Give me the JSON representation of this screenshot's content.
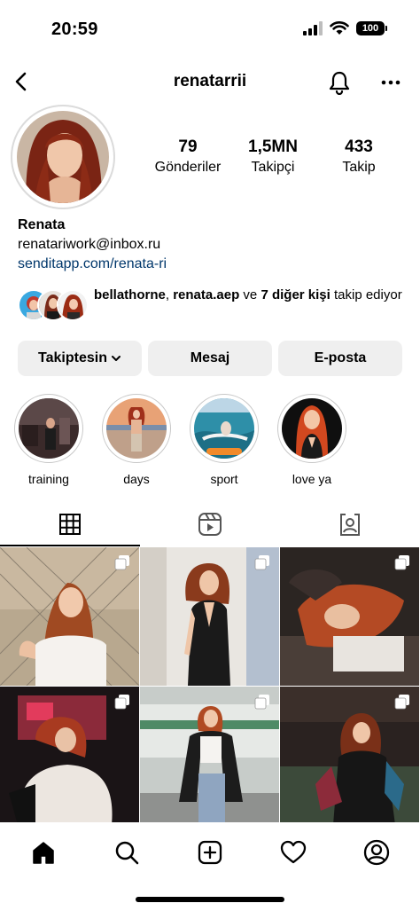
{
  "status_bar": {
    "time": "20:59",
    "battery": "100"
  },
  "header": {
    "username": "renatarrii"
  },
  "profile": {
    "stats": [
      {
        "value": "79",
        "label": "Gönderiler"
      },
      {
        "value": "1,5MN",
        "label": "Takipçi"
      },
      {
        "value": "433",
        "label": "Takip"
      }
    ],
    "name": "Renata",
    "bio_email": "renatariwork@inbox.ru",
    "bio_link": "senditapp.com/renata-ri"
  },
  "followed_by": {
    "user1": "bellathorne",
    "separator": ", ",
    "user2": "renata.aep",
    "connector": " ve ",
    "others": "7 diğer kişi",
    "suffix": " takip ediyor"
  },
  "actions": {
    "following": "Takiptesin",
    "message": "Mesaj",
    "email": "E-posta"
  },
  "highlights": [
    {
      "label": "training"
    },
    {
      "label": "days"
    },
    {
      "label": "sport"
    },
    {
      "label": "love ya"
    }
  ],
  "tabs": [
    "grid-icon",
    "reels-icon",
    "tagged-icon"
  ],
  "bottom_nav": [
    "home-icon",
    "search-icon",
    "create-icon",
    "heart-icon",
    "profile-icon"
  ],
  "colors": {
    "link": "#00376b",
    "button_bg": "#efefef",
    "ring": "#dbdbdb"
  }
}
